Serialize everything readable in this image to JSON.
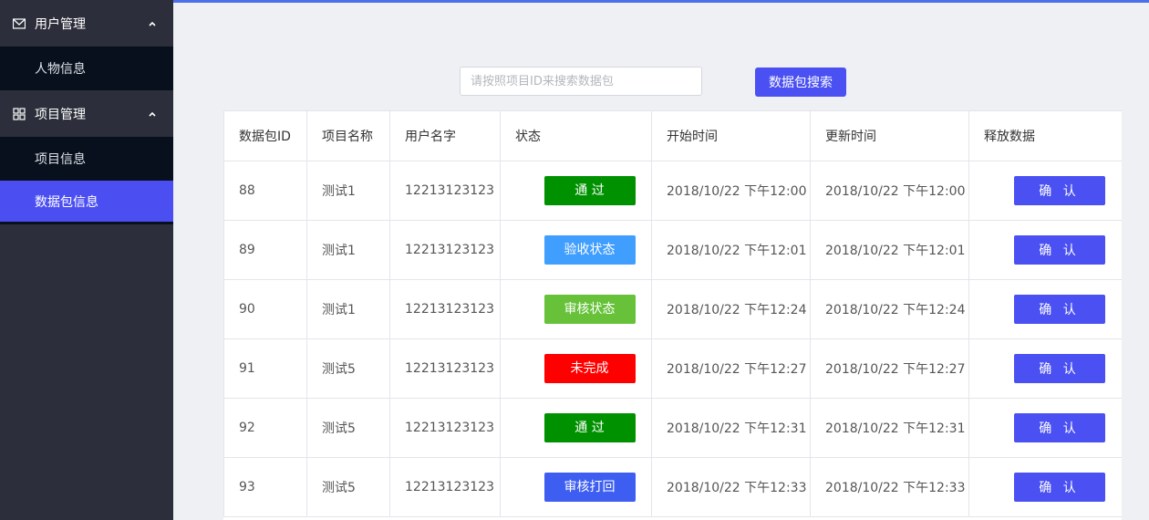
{
  "colors": {
    "accent": "#4a50f2",
    "sidebar_bg": "#2c2f3b",
    "submenu_bg": "#07101c",
    "status_pass": "#009100",
    "status_accept": "#409eff",
    "status_review": "#67c23a",
    "status_incomplete": "#ff0000",
    "status_reject": "#3d5ef0"
  },
  "sidebar": {
    "groups": [
      {
        "label": "用户管理",
        "icon": "mail-icon",
        "items": [
          "人物信息"
        ]
      },
      {
        "label": "项目管理",
        "icon": "grid-icon",
        "items": [
          "项目信息",
          "数据包信息"
        ]
      }
    ],
    "active_item": "数据包信息"
  },
  "search": {
    "placeholder": "请按照项目ID来搜索数据包",
    "value": "",
    "button_label": "数据包搜索"
  },
  "table": {
    "headers": [
      "数据包ID",
      "项目名称",
      "用户名字",
      "状态",
      "开始时间",
      "更新时间",
      "释放数据"
    ],
    "rows": [
      {
        "id": "88",
        "project": "测试1",
        "user": "12213123123",
        "status": "通 过",
        "status_color": "#009100",
        "start": "2018/10/22 下午12:00",
        "update": "2018/10/22 下午12:00",
        "action": "确 认"
      },
      {
        "id": "89",
        "project": "测试1",
        "user": "12213123123",
        "status": "验收状态",
        "status_color": "#409eff",
        "start": "2018/10/22 下午12:01",
        "update": "2018/10/22 下午12:01",
        "action": "确 认"
      },
      {
        "id": "90",
        "project": "测试1",
        "user": "12213123123",
        "status": "审核状态",
        "status_color": "#67c23a",
        "start": "2018/10/22 下午12:24",
        "update": "2018/10/22 下午12:24",
        "action": "确 认"
      },
      {
        "id": "91",
        "project": "测试5",
        "user": "12213123123",
        "status": "未完成",
        "status_color": "#ff0000",
        "start": "2018/10/22 下午12:27",
        "update": "2018/10/22 下午12:27",
        "action": "确 认"
      },
      {
        "id": "92",
        "project": "测试5",
        "user": "12213123123",
        "status": "通 过",
        "status_color": "#009100",
        "start": "2018/10/22 下午12:31",
        "update": "2018/10/22 下午12:31",
        "action": "确 认"
      },
      {
        "id": "93",
        "project": "测试5",
        "user": "12213123123",
        "status": "审核打回",
        "status_color": "#3d5ef0",
        "start": "2018/10/22 下午12:33",
        "update": "2018/10/22 下午12:33",
        "action": "确 认"
      }
    ]
  }
}
